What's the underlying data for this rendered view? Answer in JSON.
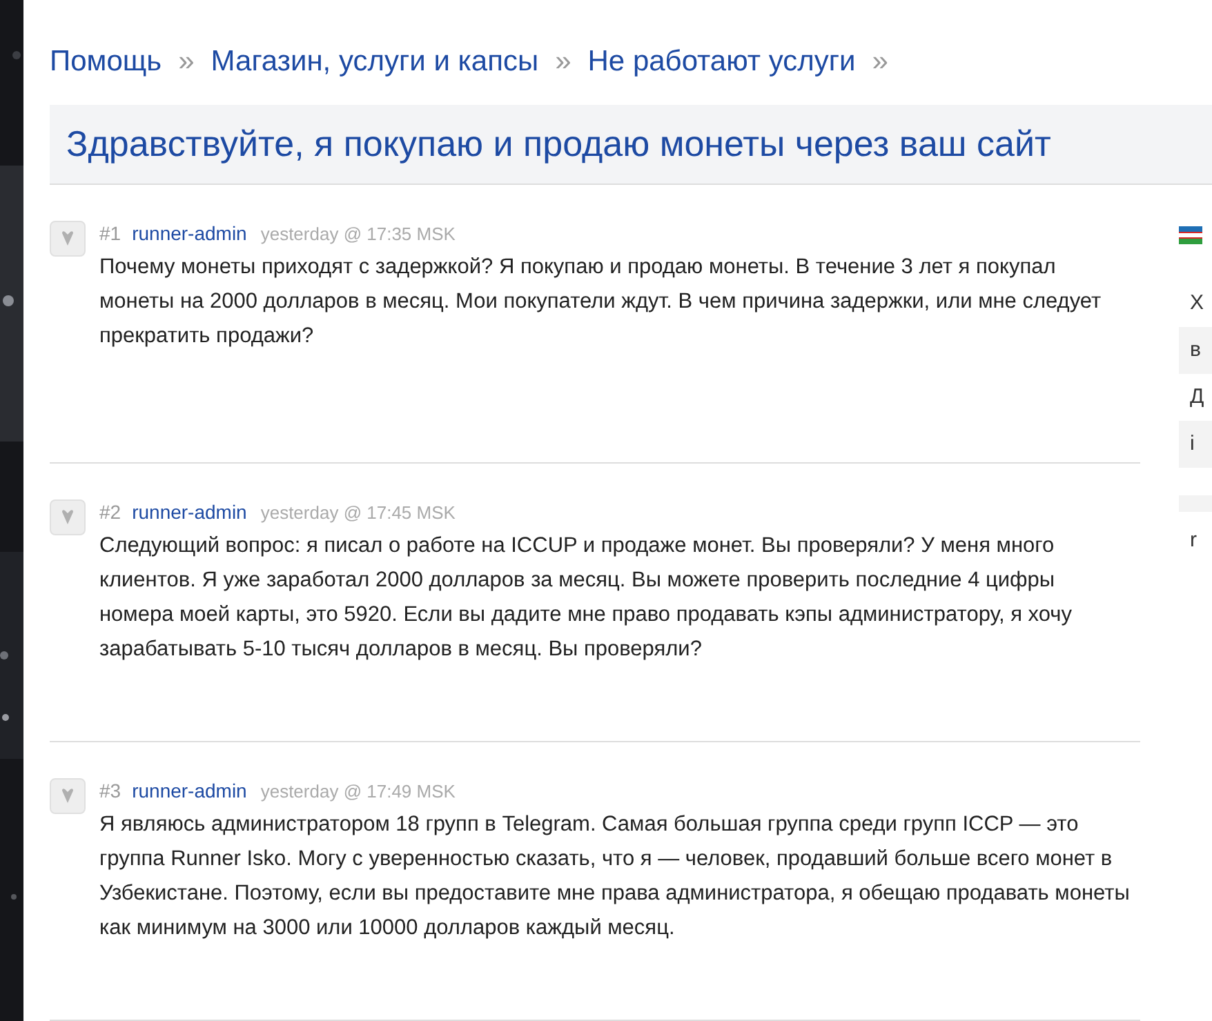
{
  "breadcrumbs": [
    {
      "label": "Помощь",
      "separator": "»"
    },
    {
      "label": "Магазин, услуги и капсы",
      "separator": "»"
    },
    {
      "label": "Не работают услуги",
      "separator": "»"
    }
  ],
  "title": "Здравствуйте, я покупаю и продаю монеты через ваш сайт",
  "posts": [
    {
      "number": "#1",
      "author": "runner-admin",
      "time": "yesterday @ 17:35 MSK",
      "body": "Почему монеты приходят с задержкой? Я покупаю и продаю монеты. В течение 3 лет я покупал монеты на 2000 долларов в месяц. Мои покупатели ждут. В чем причина задержки, или мне следует прекратить продажи?"
    },
    {
      "number": "#2",
      "author": "runner-admin",
      "time": "yesterday @ 17:45 MSK",
      "body": "Следующий вопрос: я писал о работе на ICCUP и продаже монет. Вы проверяли? У меня много клиентов. Я уже заработал 2000 долларов за месяц. Вы можете проверить последние 4 цифры номера моей карты, это 5920. Если вы дадите мне право продавать кэпы администратору, я хочу зарабатывать 5-10 тысяч долларов в месяц. Вы проверяли?"
    },
    {
      "number": "#3",
      "author": "runner-admin",
      "time": "yesterday @ 17:49 MSK",
      "body": "Я являюсь администратором 18 групп в Telegram. Самая большая группа среди групп ICCP — это группа Runner Isko. Могу с уверенностью сказать, что я — человек, продавший больше всего монет в Узбекистане. Поэтому, если вы предоставите мне права администратора, я обещаю продавать монеты как минимум на 3000 или 10000 долларов каждый месяц."
    }
  ],
  "sidebar": {
    "items": [
      {
        "kind": "text",
        "label": "Х",
        "shaded": false
      },
      {
        "kind": "text",
        "label": "в",
        "shaded": true
      },
      {
        "kind": "text",
        "label": "Д",
        "shaded": false
      },
      {
        "kind": "text",
        "label": "i",
        "shaded": true
      },
      {
        "kind": "bar",
        "shaded": true
      },
      {
        "kind": "text",
        "label": "r",
        "shaded": false
      }
    ]
  }
}
